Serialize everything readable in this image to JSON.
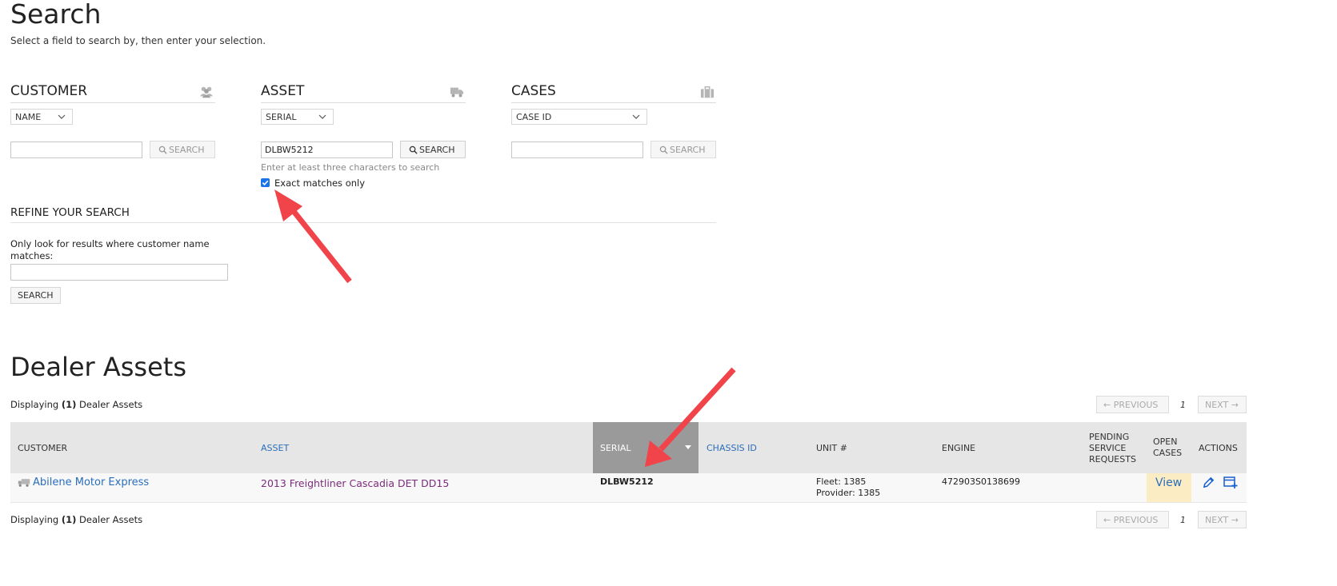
{
  "page": {
    "title": "Search",
    "subtitle": "Select a field to search by, then enter your selection."
  },
  "customer": {
    "heading": "CUSTOMER",
    "icon": "users-icon",
    "field": "NAME",
    "value": "",
    "search_label": "SEARCH"
  },
  "asset": {
    "heading": "ASSET",
    "icon": "truck-icon",
    "field": "SERIAL",
    "value": "DLBW5212",
    "search_label": "SEARCH",
    "hint": "Enter at least three characters to search",
    "exact_label": "Exact matches only",
    "exact_checked": true
  },
  "cases": {
    "heading": "CASES",
    "icon": "briefcase-icon",
    "field": "CASE ID",
    "value": "",
    "search_label": "SEARCH"
  },
  "refine": {
    "heading": "REFINE YOUR SEARCH",
    "label": "Only look for results where customer name matches:",
    "value": "",
    "button": "SEARCH"
  },
  "results": {
    "title": "Dealer Assets",
    "displaying_prefix": "Displaying",
    "count": "(1)",
    "displaying_suffix": "Dealer Assets",
    "pager": {
      "previous": "← PREVIOUS",
      "page": "1",
      "next": "NEXT →"
    },
    "columns": {
      "customer": "CUSTOMER",
      "asset": "ASSET",
      "serial": "SERIAL",
      "chassis": "CHASSIS ID",
      "unit": "UNIT #",
      "engine": "ENGINE",
      "pending_1": "PENDING",
      "pending_2": "SERVICE",
      "pending_3": "REQUESTS",
      "open_1": "OPEN",
      "open_2": "CASES",
      "actions": "ACTIONS"
    },
    "row": {
      "customer": "Abilene Motor Express",
      "asset": "2013 Freightliner Cascadia DET DD15",
      "serial": "DLBW5212",
      "chassis": "",
      "fleet": "Fleet: 1385",
      "provider": "Provider: 1385",
      "engine": "472903S0138699",
      "open_cases": "View"
    }
  },
  "colors": {
    "link": "#2a6ebb",
    "asset_link": "#7b2c7b",
    "sorted_header": "#9a9a9a",
    "highlight": "#fbecc4",
    "arrow": "#f0444a"
  }
}
